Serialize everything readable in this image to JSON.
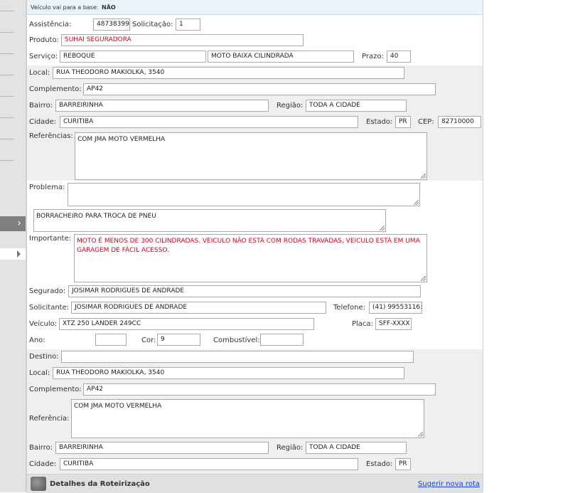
{
  "base_bar": {
    "label": "Veículo vai para a base:",
    "value": "NÃO"
  },
  "form": {
    "assistencia_label": "Assistência:",
    "assistencia": "48738399",
    "solicitacao_label": "Solicitação:",
    "solicitacao": "1",
    "produto_label": "Produto:",
    "produto": "SUHAI SEGURADORA",
    "servico_label": "Serviço:",
    "servico": "REBOQUE",
    "servico_tipo": "MOTO BAIXA CILINDRADA",
    "prazo_label": "Prazo:",
    "prazo": "40",
    "local_label": "Local:",
    "local": "RUA THEODORO MAKIOLKA, 3540",
    "complemento_label": "Complemento:",
    "complemento": "AP42",
    "bairro_label": "Bairro:",
    "bairro": "BARREIRINHA",
    "regiao_label": "Região:",
    "regiao": "TODA A CIDADE",
    "cidade_label": "Cidade:",
    "cidade": "CURITIBA",
    "estado_label": "Estado:",
    "estado": "PR",
    "cep_label": "CEP:",
    "cep": "82710000",
    "referencias_label": "Referências:",
    "referencias": "COM JMA MOTO VERMELHA",
    "problema_label": "Problema:",
    "problema": "",
    "problema_detalhe": "BORRACHEIRO PARA TROCA DE PNEU",
    "importante_label": "Importante:",
    "importante": "MOTO É MENOS DE 300 CILINDRADAS. VEICULO NÃO ESTÁ COM RODAS TRAVADAS, VEICULO ESTÁ EM UMA GARAGEM DE FÁCIL ACESSO.",
    "segurado_label": "Segurado:",
    "segurado": "JOSIMAR RODRIGUES DE ANDRADE",
    "solicitante_label": "Solicitante:",
    "solicitante": "JOSIMAR RODRIGUES DE ANDRADE",
    "telefone_label": "Telefone:",
    "telefone": "(41) 99553116:",
    "veiculo_label": "Veículo:",
    "veiculo": "XTZ 250 LANDER 249CC",
    "placa_label": "Placa:",
    "placa": "SFF-XXXX",
    "ano_label": "Ano:",
    "ano": "",
    "cor_label": "Cor:",
    "cor": "9",
    "combustivel_label": "Combustível:",
    "combustivel": ""
  },
  "destino": {
    "destino_label": "Destino:",
    "destino": "",
    "local_label": "Local:",
    "local": "RUA THEODORO MAKIOLKA, 3540",
    "complemento_label": "Complemento:",
    "complemento": "AP42",
    "referencia_label": "Referência:",
    "referencia": "COM JMA MOTO VERMELHA",
    "bairro_label": "Bairro:",
    "bairro": "BARREIRINHA",
    "regiao_label": "Região:",
    "regiao": "TODA A CIDADE",
    "cidade_label": "Cidade:",
    "cidade": "CURITIBA",
    "estado_label": "Estado:",
    "estado": "PR"
  },
  "footer": {
    "title": "Detalhes da Roteirização",
    "link": "Sugerir nova rota",
    "icon": "globe-icon"
  },
  "colors": {
    "accent_red": "#d0021b",
    "link_blue": "#1a3fd6",
    "band_gray": "#efefef"
  }
}
